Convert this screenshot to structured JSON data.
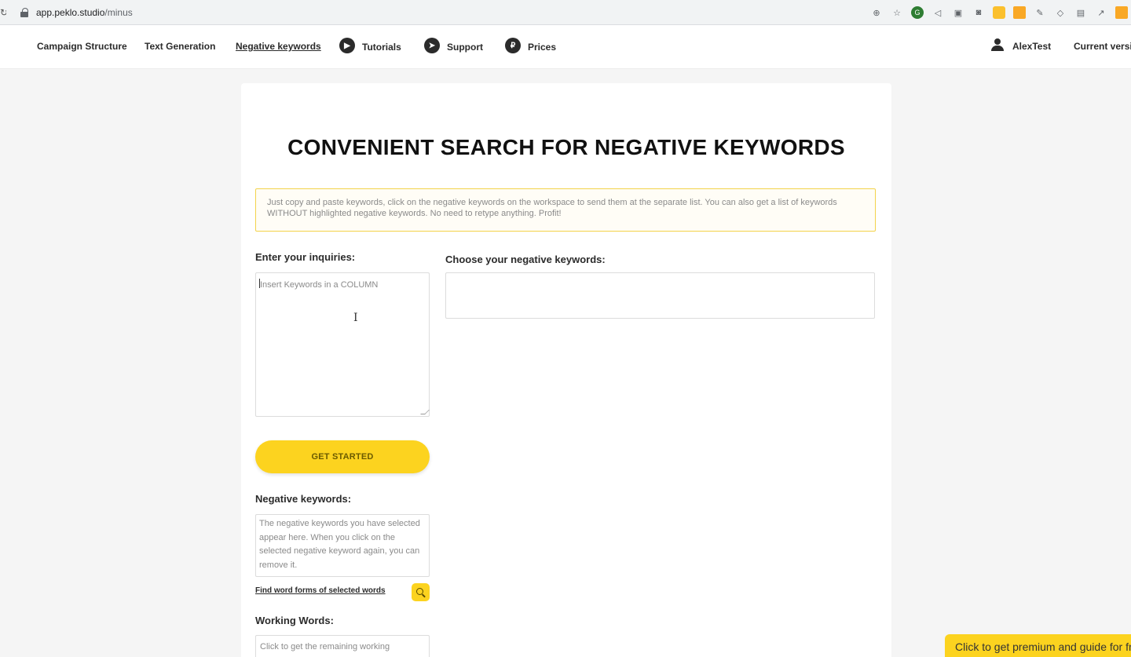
{
  "browser": {
    "url_host": "app.peklo.studio",
    "url_path": "/minus"
  },
  "nav": {
    "items": [
      {
        "label": "Campaign Structure",
        "icon": ""
      },
      {
        "label": "Text Generation",
        "icon": ""
      },
      {
        "label": "Negative keywords",
        "icon": "",
        "active": true
      },
      {
        "label": "Tutorials",
        "icon": "youtube-icon"
      },
      {
        "label": "Support",
        "icon": "telegram-icon"
      },
      {
        "label": "Prices",
        "icon": "ruble-icon"
      }
    ],
    "user_name": "AlexTest",
    "version_label": "Current versio"
  },
  "page": {
    "title": "CONVENIENT SEARCH FOR NEGATIVE KEYWORDS",
    "info": "Just copy and paste keywords, click on the negative keywords on the workspace to send them at the separate list. You can also get a list of keywords WITHOUT highlighted negative keywords. No need to retype anything. Profit!",
    "inquiries_label": "Enter your inquiries:",
    "inquiries_placeholder": "Insert Keywords in a COLUMN",
    "choose_label": "Choose your negative keywords:",
    "get_started_label": "GET STARTED",
    "negative_label": "Negative keywords:",
    "negative_placeholder": "The negative keywords you have selected appear here. When you click on the selected negative keyword again, you can remove it.",
    "find_forms_label": "Find word forms of selected words",
    "working_label": "Working Words:",
    "working_placeholder": "Click to get the remaining working"
  },
  "promo": {
    "text": "Click to get premium and guide for free"
  },
  "colors": {
    "accent": "#fcd31f",
    "info_border": "#f3d34a"
  }
}
